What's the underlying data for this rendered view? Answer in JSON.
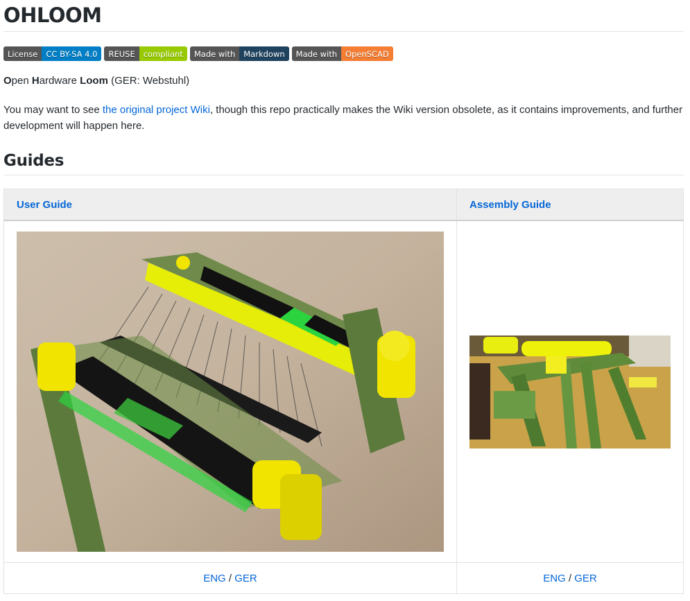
{
  "title": "OHLOOM",
  "badges": [
    {
      "left": "License",
      "right": "CC BY-SA 4.0",
      "color": "#007ec6"
    },
    {
      "left": "REUSE",
      "right": "compliant",
      "color": "#97ca00"
    },
    {
      "left": "Made with",
      "right": "Markdown",
      "color": "#1f425f"
    },
    {
      "left": "Made with",
      "right": "OpenSCAD",
      "color": "#f37e34"
    }
  ],
  "intro": {
    "o": "O",
    "pen": "pen ",
    "h": "H",
    "ardware": "ardware ",
    "loom": "Loom",
    "ger": " (GER: Webstuhl)"
  },
  "note": {
    "before": "You may want to see ",
    "link": "the original project Wiki",
    "after": ", though this repo practically makes the Wiki version obsolete, as it contains improvements, and further development will happen here."
  },
  "guides_heading": "Guides",
  "table": {
    "columns": [
      {
        "header": "User Guide",
        "eng": "ENG",
        "sep": " / ",
        "ger": "GER"
      },
      {
        "header": "Assembly Guide",
        "eng": "ENG",
        "sep": " / ",
        "ger": "GER"
      }
    ]
  },
  "colors": {
    "link": "#0366d6",
    "text": "#24292e"
  }
}
